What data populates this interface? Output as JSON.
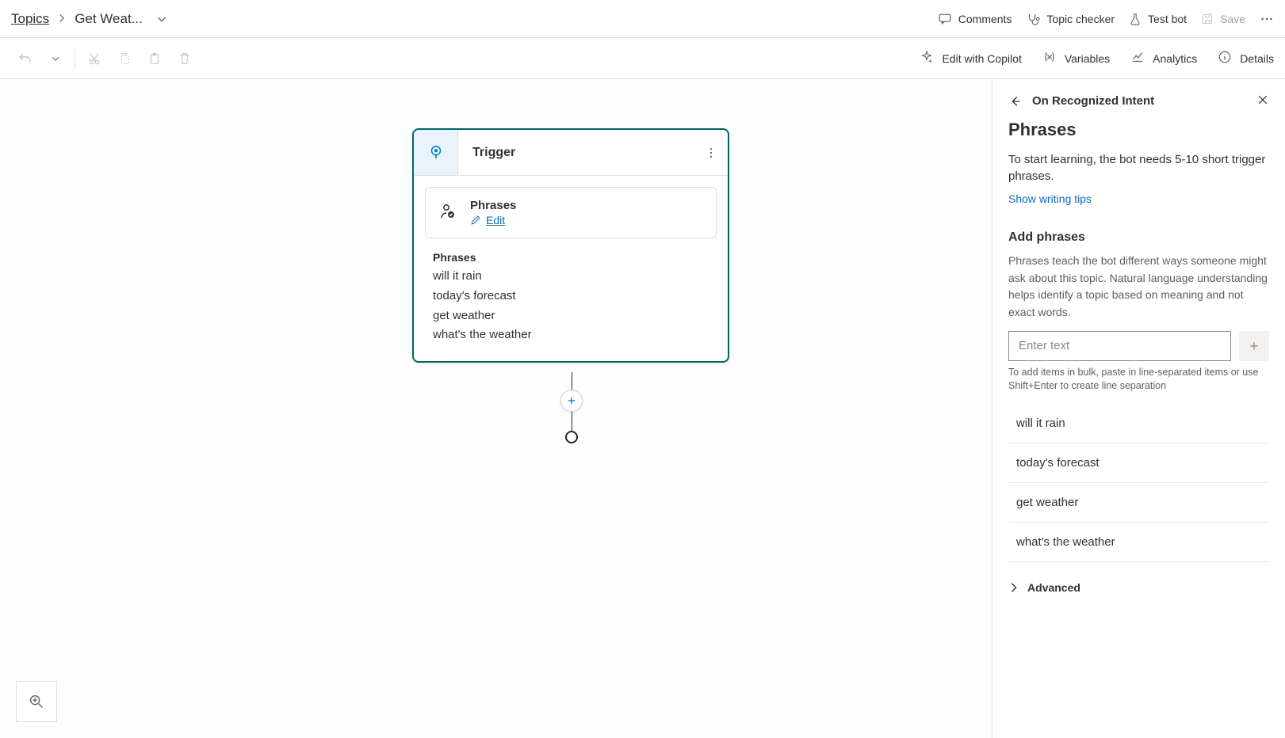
{
  "breadcrumb": {
    "root": "Topics",
    "current": "Get Weat..."
  },
  "topActions": {
    "comments": "Comments",
    "topicChecker": "Topic checker",
    "testBot": "Test bot",
    "save": "Save"
  },
  "toolbar": {
    "editCopilot": "Edit with Copilot",
    "variables": "Variables",
    "analytics": "Analytics",
    "details": "Details"
  },
  "node": {
    "title": "Trigger",
    "sectionTitle": "Phrases",
    "editLabel": "Edit",
    "listTitle": "Phrases",
    "phrases": [
      "will it rain",
      "today's forecast",
      "get weather",
      "what's the weather"
    ]
  },
  "panel": {
    "headerTitle": "On Recognized Intent",
    "heading": "Phrases",
    "lead": "To start learning, the bot needs 5-10 short trigger phrases.",
    "tipsLink": "Show writing tips",
    "addHeading": "Add phrases",
    "addDesc": "Phrases teach the bot different ways someone might ask about this topic. Natural language understanding helps identify a topic based on meaning and not exact words.",
    "inputPlaceholder": "Enter text",
    "hint": "To add items in bulk, paste in line-separated items or use Shift+Enter to create line separation",
    "phrases": [
      "will it rain",
      "today's forecast",
      "get weather",
      "what's the weather"
    ],
    "advanced": "Advanced"
  }
}
